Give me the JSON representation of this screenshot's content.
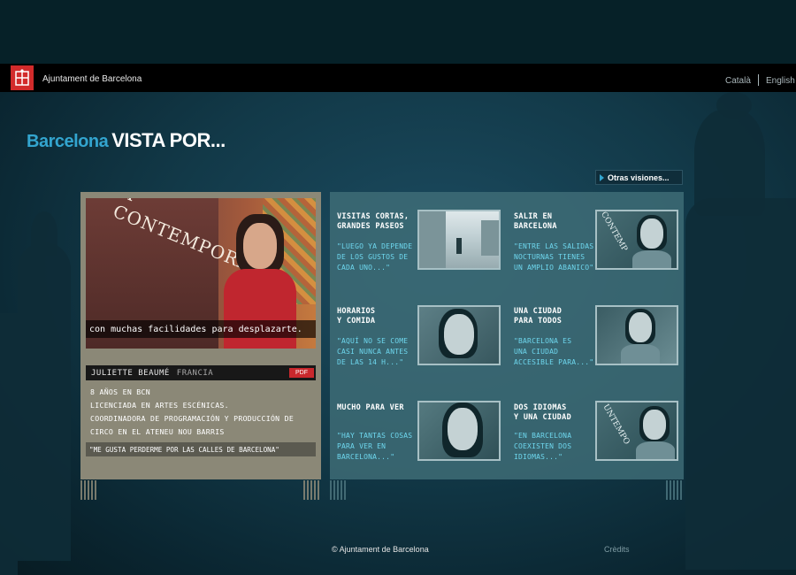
{
  "header": {
    "org_name": "Ajuntament de Barcelona",
    "languages": [
      "Català",
      "English"
    ]
  },
  "page": {
    "title_city": "Barcelona",
    "title_rest": "VISTA POR...",
    "other_visions_label": "Otras visiones..."
  },
  "video": {
    "watermark": "A CONTEMPORÀNIA",
    "subtitle": "con muchas facilidades para desplazarte."
  },
  "profile": {
    "name": "JULIETTE BEAUMÉ",
    "country": "FRANCIA",
    "pdf_label": "PDF",
    "bio": [
      "8 AÑOS EN BCN",
      "LICENCIADA EN ARTES ESCÉNICAS.",
      "COORDINADORA DE PROGRAMACIÓN Y PRODUCCIÓN DE",
      "CIRCO EN EL ATENEU NOU BARRIS"
    ],
    "quote": "\"ME GUSTA PERDERME POR LAS CALLES DE BARCELONA\""
  },
  "topics": [
    {
      "title": [
        "VISITAS CORTAS,",
        "GRANDES PASEOS"
      ],
      "desc": [
        "\"LUEGO YA DEPENDE",
        "DE LOS GUSTOS DE",
        "CADA UNO...\""
      ]
    },
    {
      "title": [
        "SALIR EN",
        "BARCELONA"
      ],
      "desc": [
        "\"ENTRE LAS SALIDAS",
        "NOCTURNAS TIENES",
        "UN AMPLIO ABANICO\""
      ]
    },
    {
      "title": [
        "HORARIOS",
        "Y COMIDA"
      ],
      "desc": [
        "\"AQUÍ NO SE COME",
        "CASI NUNCA ANTES",
        "DE LAS 14 H...\""
      ]
    },
    {
      "title": [
        "UNA CIUDAD",
        "PARA TODOS"
      ],
      "desc": [
        "\"BARCELONA ES",
        "UNA CIUDAD",
        "ACCESIBLE PARA...\""
      ]
    },
    {
      "title": [
        "MUCHO PARA VER"
      ],
      "desc": [
        "\"HAY TANTAS COSAS",
        "PARA VER EN",
        "BARCELONA...\""
      ]
    },
    {
      "title": [
        "DOS IDIOMAS",
        "Y UNA CIUDAD"
      ],
      "desc": [
        "\"EN BARCELONA",
        "COEXISTEN DOS",
        "IDIOMAS...\""
      ]
    }
  ],
  "footer": {
    "copyright": "© Ajuntament de Barcelona",
    "credits": "Crèdits"
  },
  "colors": {
    "accent_blue": "#33a5cf",
    "brand_red": "#d22b2b",
    "topic_desc": "#6ed7ee"
  }
}
